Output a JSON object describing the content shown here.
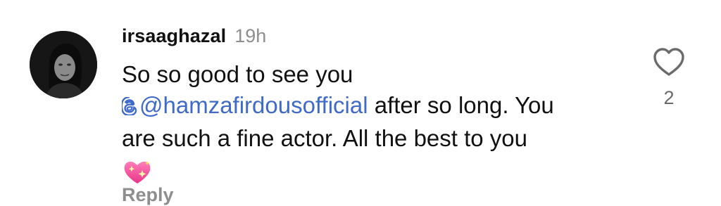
{
  "comment": {
    "username": "irsaaghazal",
    "timestamp": "19h",
    "text_line_1": "So so good to see you",
    "mention": "@hamzafirdousofficial",
    "text_line_2_after_mention": " after so long. You",
    "text_line_3": "are such a fine actor. All the best to you",
    "emoji": "sparkling-heart",
    "reply_label": "Reply",
    "like_count": "2",
    "mention_color": "#3f6ac8",
    "timestamp_color": "#8e8e8e"
  }
}
